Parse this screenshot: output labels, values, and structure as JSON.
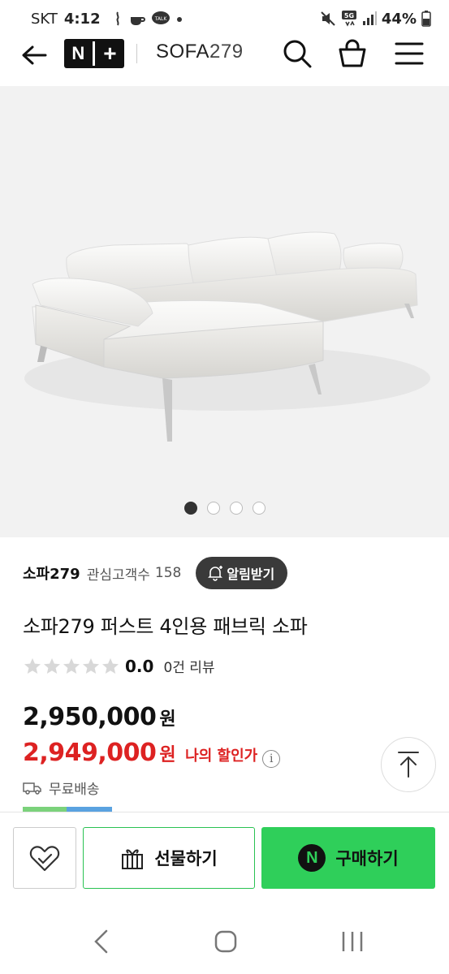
{
  "status_bar": {
    "carrier": "SKT",
    "time": "4:12",
    "network": "5G",
    "battery": "44%"
  },
  "top_nav": {
    "logo_n": "N",
    "logo_plus": "+",
    "brand_main": "SOFA",
    "brand_num": "279",
    "icons": [
      "back-arrow-icon",
      "search-icon",
      "shopping-bag-icon",
      "menu-icon"
    ]
  },
  "gallery": {
    "slides": 4,
    "active_index": 0
  },
  "store": {
    "name": "소파279",
    "fans_label": "관심고객수",
    "fans_count": "158",
    "alarm_label": "알림받기"
  },
  "product": {
    "title": "소파279 퍼스트 4인용 패브릭 소파",
    "rating": "0.0",
    "rating_stars": 0,
    "reviews": "0건 리뷰",
    "original_price": "2,950,000",
    "sale_price": "2,949,000",
    "currency": "원",
    "my_discount_label": "나의 할인가",
    "info_symbol": "i",
    "shipping": "무료배송"
  },
  "actions": {
    "gift_label": "선물하기",
    "buy_label": "구매하기",
    "npay_letter": "N"
  },
  "colors": {
    "sale_red": "#dd2222",
    "naver_green": "#2fcf5a",
    "gift_border": "#29c252"
  }
}
